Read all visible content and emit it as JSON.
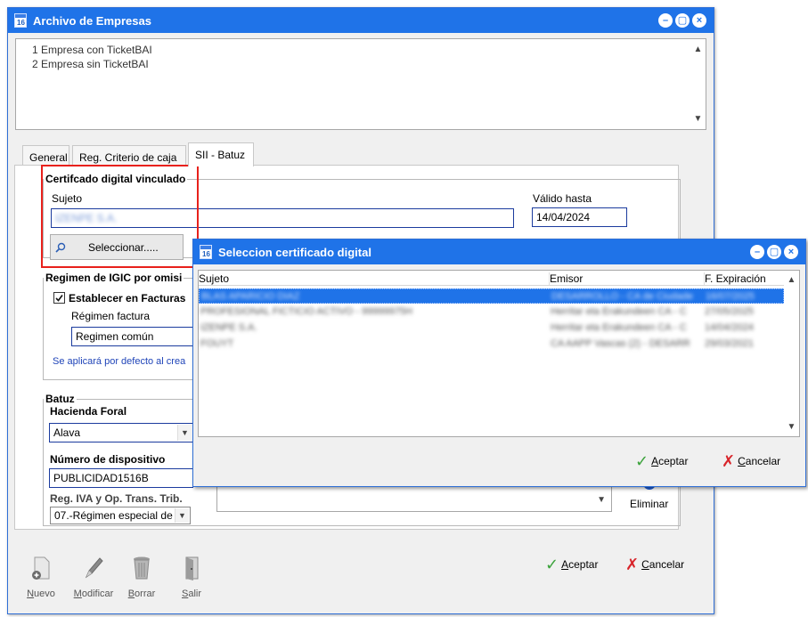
{
  "main": {
    "title": "Archivo de Empresas",
    "app_icon_text": "16",
    "win_min": "–",
    "win_restore": "▢",
    "win_close": "×",
    "company_list": [
      "1 Empresa con TicketBAI",
      "2 Empresa sin TicketBAI"
    ],
    "tabs": [
      {
        "label": "General",
        "active": false
      },
      {
        "label": "Reg. Criterio de caja",
        "active": false
      },
      {
        "label": "SII - Batuz",
        "active": true
      }
    ],
    "cert": {
      "legend": "Certifcado digital vinculado",
      "subject_label": "Sujeto",
      "subject_value": "IZENPE S.A.",
      "valid_label": "Válido hasta",
      "valid_value": "14/04/2024",
      "select_button": "Seleccionar....."
    },
    "igic": {
      "legend": "Regimen de IGIC por omisi",
      "checkbox_label": "Establecer en Facturas",
      "checked": true,
      "regimen_label": "Régimen factura",
      "regimen_value": "Regimen común",
      "note": "Se aplicará por defecto al crea"
    },
    "batuz": {
      "legend": "Batuz",
      "hacienda_label": "Hacienda Foral",
      "hacienda_value": "Alava",
      "device_label": "Número de dispositivo",
      "device_value": "PUBLICIDAD1516B",
      "iva_label": "Reg. IVA y Op. Trans. Trib.",
      "iva_value": "07.-Régimen especial de"
    },
    "eliminar": "Eliminar",
    "accept": "Aceptar",
    "cancel": "Cancelar",
    "toolbar": [
      {
        "label": "Nuevo",
        "icon": "new-document-icon"
      },
      {
        "label": "Modificar",
        "icon": "pencil-icon"
      },
      {
        "label": "Borrar",
        "icon": "trash-icon"
      },
      {
        "label": "Salir",
        "icon": "exit-door-icon"
      }
    ]
  },
  "dialog": {
    "title": "Seleccion certificado digital",
    "columns": [
      "Sujeto",
      "Emisor",
      "F. Expiración"
    ],
    "rows": [
      {
        "sujeto": "BLAS APARICIO DIAZ",
        "emisor": "DESARROLLO - CA de Ciudade",
        "fecha": "16/07/2025",
        "selected": true
      },
      {
        "sujeto": "PROFESIONAL FICTICIO ACTIVO - 99999975H",
        "emisor": "Herritar eta Erakundeen CA - C",
        "fecha": "27/05/2025",
        "selected": false
      },
      {
        "sujeto": "IZENPE S.A.",
        "emisor": "Herritar eta Erakundeen CA - C",
        "fecha": "14/04/2024",
        "selected": false
      },
      {
        "sujeto": "FOUYT",
        "emisor": "CA AAPP Vascas (2) - DESARR",
        "fecha": "29/03/2021",
        "selected": false
      }
    ],
    "accept": "Aceptar",
    "cancel": "Cancelar"
  }
}
